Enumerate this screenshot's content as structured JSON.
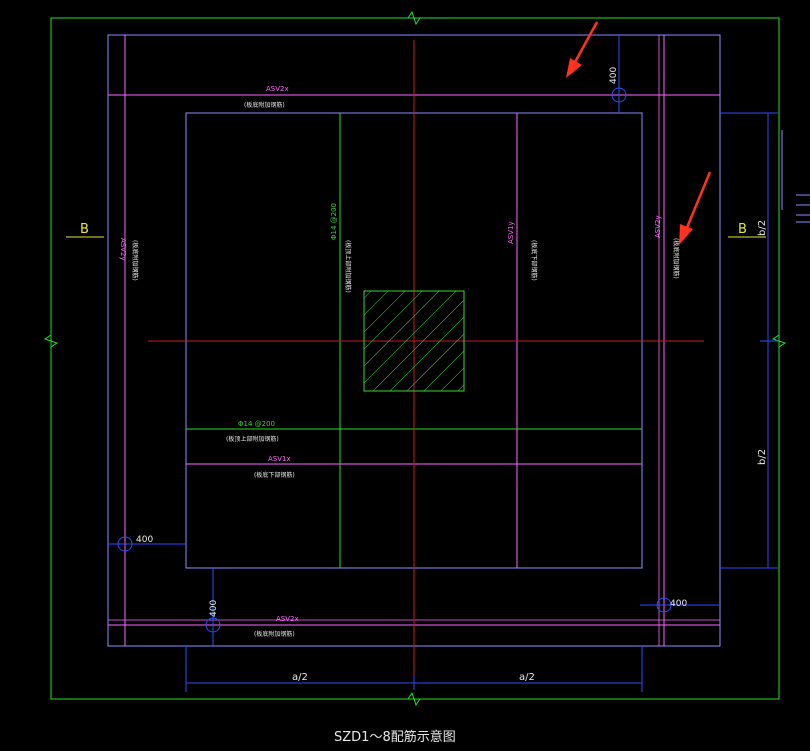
{
  "drawing": {
    "title": "SZD1～8配筋示意图",
    "section_marks": [
      "B",
      "B"
    ],
    "dim_a_half": [
      "a/2",
      "a/2"
    ],
    "dim_b_half": [
      "b/2",
      "b/2"
    ],
    "dim_400": [
      "400",
      "400",
      "400",
      "400"
    ],
    "rebar_labels": {
      "asv2x_top": "ASV2x",
      "asv2x_top_note": "(板底附加钢筋)",
      "asv2x_bottom": "ASV2x",
      "asv2x_bottom_note": "(板底附加钢筋)",
      "asv2y_left": "ASV2y",
      "asv2y_left_note": "(板底附加钢筋)",
      "asv2y_right": "ASV2y",
      "asv2y_right_note": "(板底附加钢筋)",
      "asv1y": "ASV1y",
      "asv1y_note": "(板底下部钢筋)",
      "asv1x": "ASV1x",
      "asv1x_note": "(板底下部钢筋)",
      "phi14_v": "Φ14 @200",
      "phi14_v_note": "(板顶上部附加钢筋)",
      "phi14_h": "Φ14 @200",
      "phi14_h_note": "(板顶上部附加钢筋)"
    },
    "colors": {
      "background": "#000000",
      "outline_green": "#22e022",
      "slab_magenta": "#ff66ff",
      "frame_blue": "#8c8cff",
      "dimension_blue": "#2a4dff",
      "center_red": "#c81e1e",
      "column_hatch": "#3cd23c",
      "label_yellow": "#e6e632",
      "annotation_arrow": "#ff3220",
      "text_white": "#e8e8e8"
    }
  }
}
